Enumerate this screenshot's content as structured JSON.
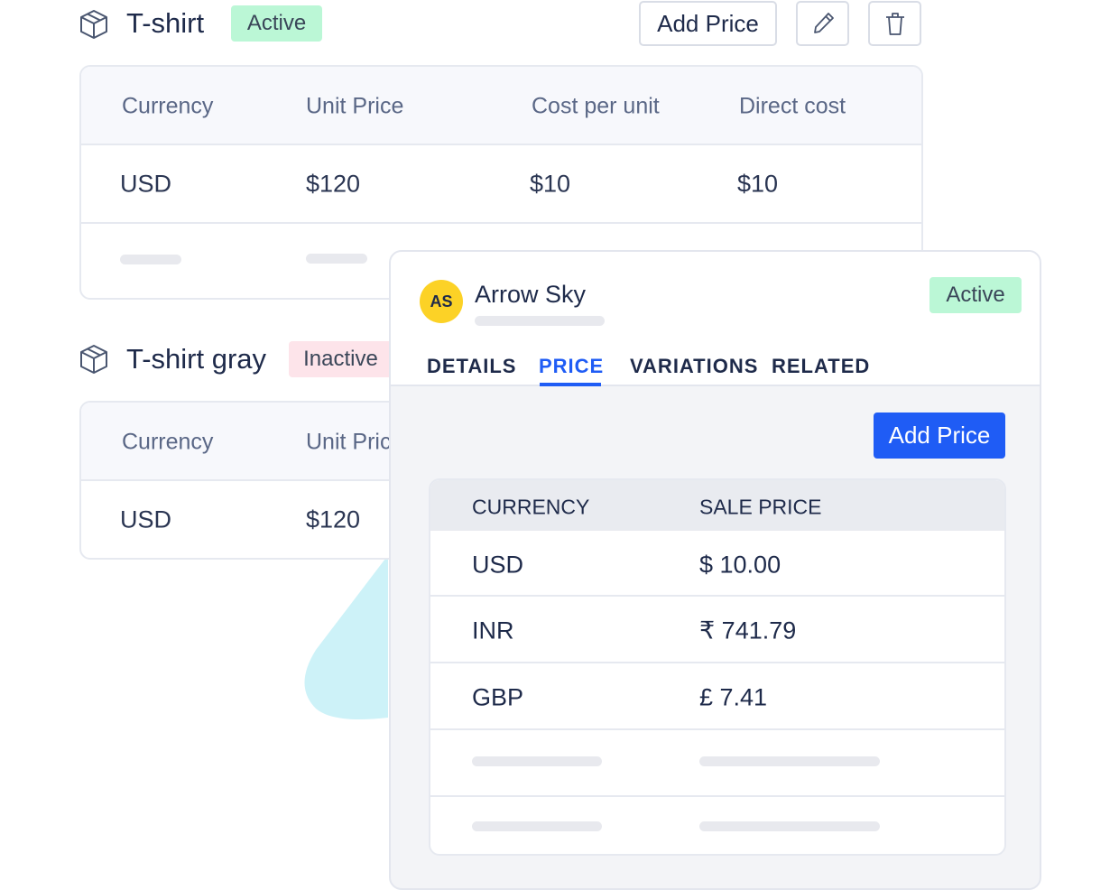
{
  "products": [
    {
      "name": "T-shirt",
      "status": "Active",
      "headers": [
        "Currency",
        "Unit Price",
        "Cost per unit",
        "Direct cost"
      ],
      "rows": [
        [
          "USD",
          "$120",
          "$10",
          "$10"
        ]
      ]
    },
    {
      "name": "T-shirt gray",
      "status": "Inactive",
      "headers": [
        "Currency",
        "Unit Price"
      ],
      "rows": [
        [
          "USD",
          "$120"
        ]
      ]
    }
  ],
  "toolbar": {
    "add_price": "Add Price",
    "edit_icon": "pencil-icon",
    "delete_icon": "trash-icon"
  },
  "panel": {
    "avatar_initials": "AS",
    "name": "Arrow Sky",
    "status": "Active",
    "tabs": [
      "DETAILS",
      "PRICE",
      "VARIATIONS",
      "RELATED"
    ],
    "active_tab": "PRICE",
    "add_price": "Add Price",
    "headers": [
      "CURRENCY",
      "SALE PRICE"
    ],
    "rows": [
      [
        "USD",
        "$ 10.00"
      ],
      [
        "INR",
        "₹ 741.79"
      ],
      [
        "GBP",
        "£ 7.41"
      ]
    ]
  },
  "colors": {
    "accent": "#1f5cf5",
    "active_badge": "#bbf7d6",
    "inactive_badge": "#fde4ea",
    "avatar": "#fcd226"
  }
}
